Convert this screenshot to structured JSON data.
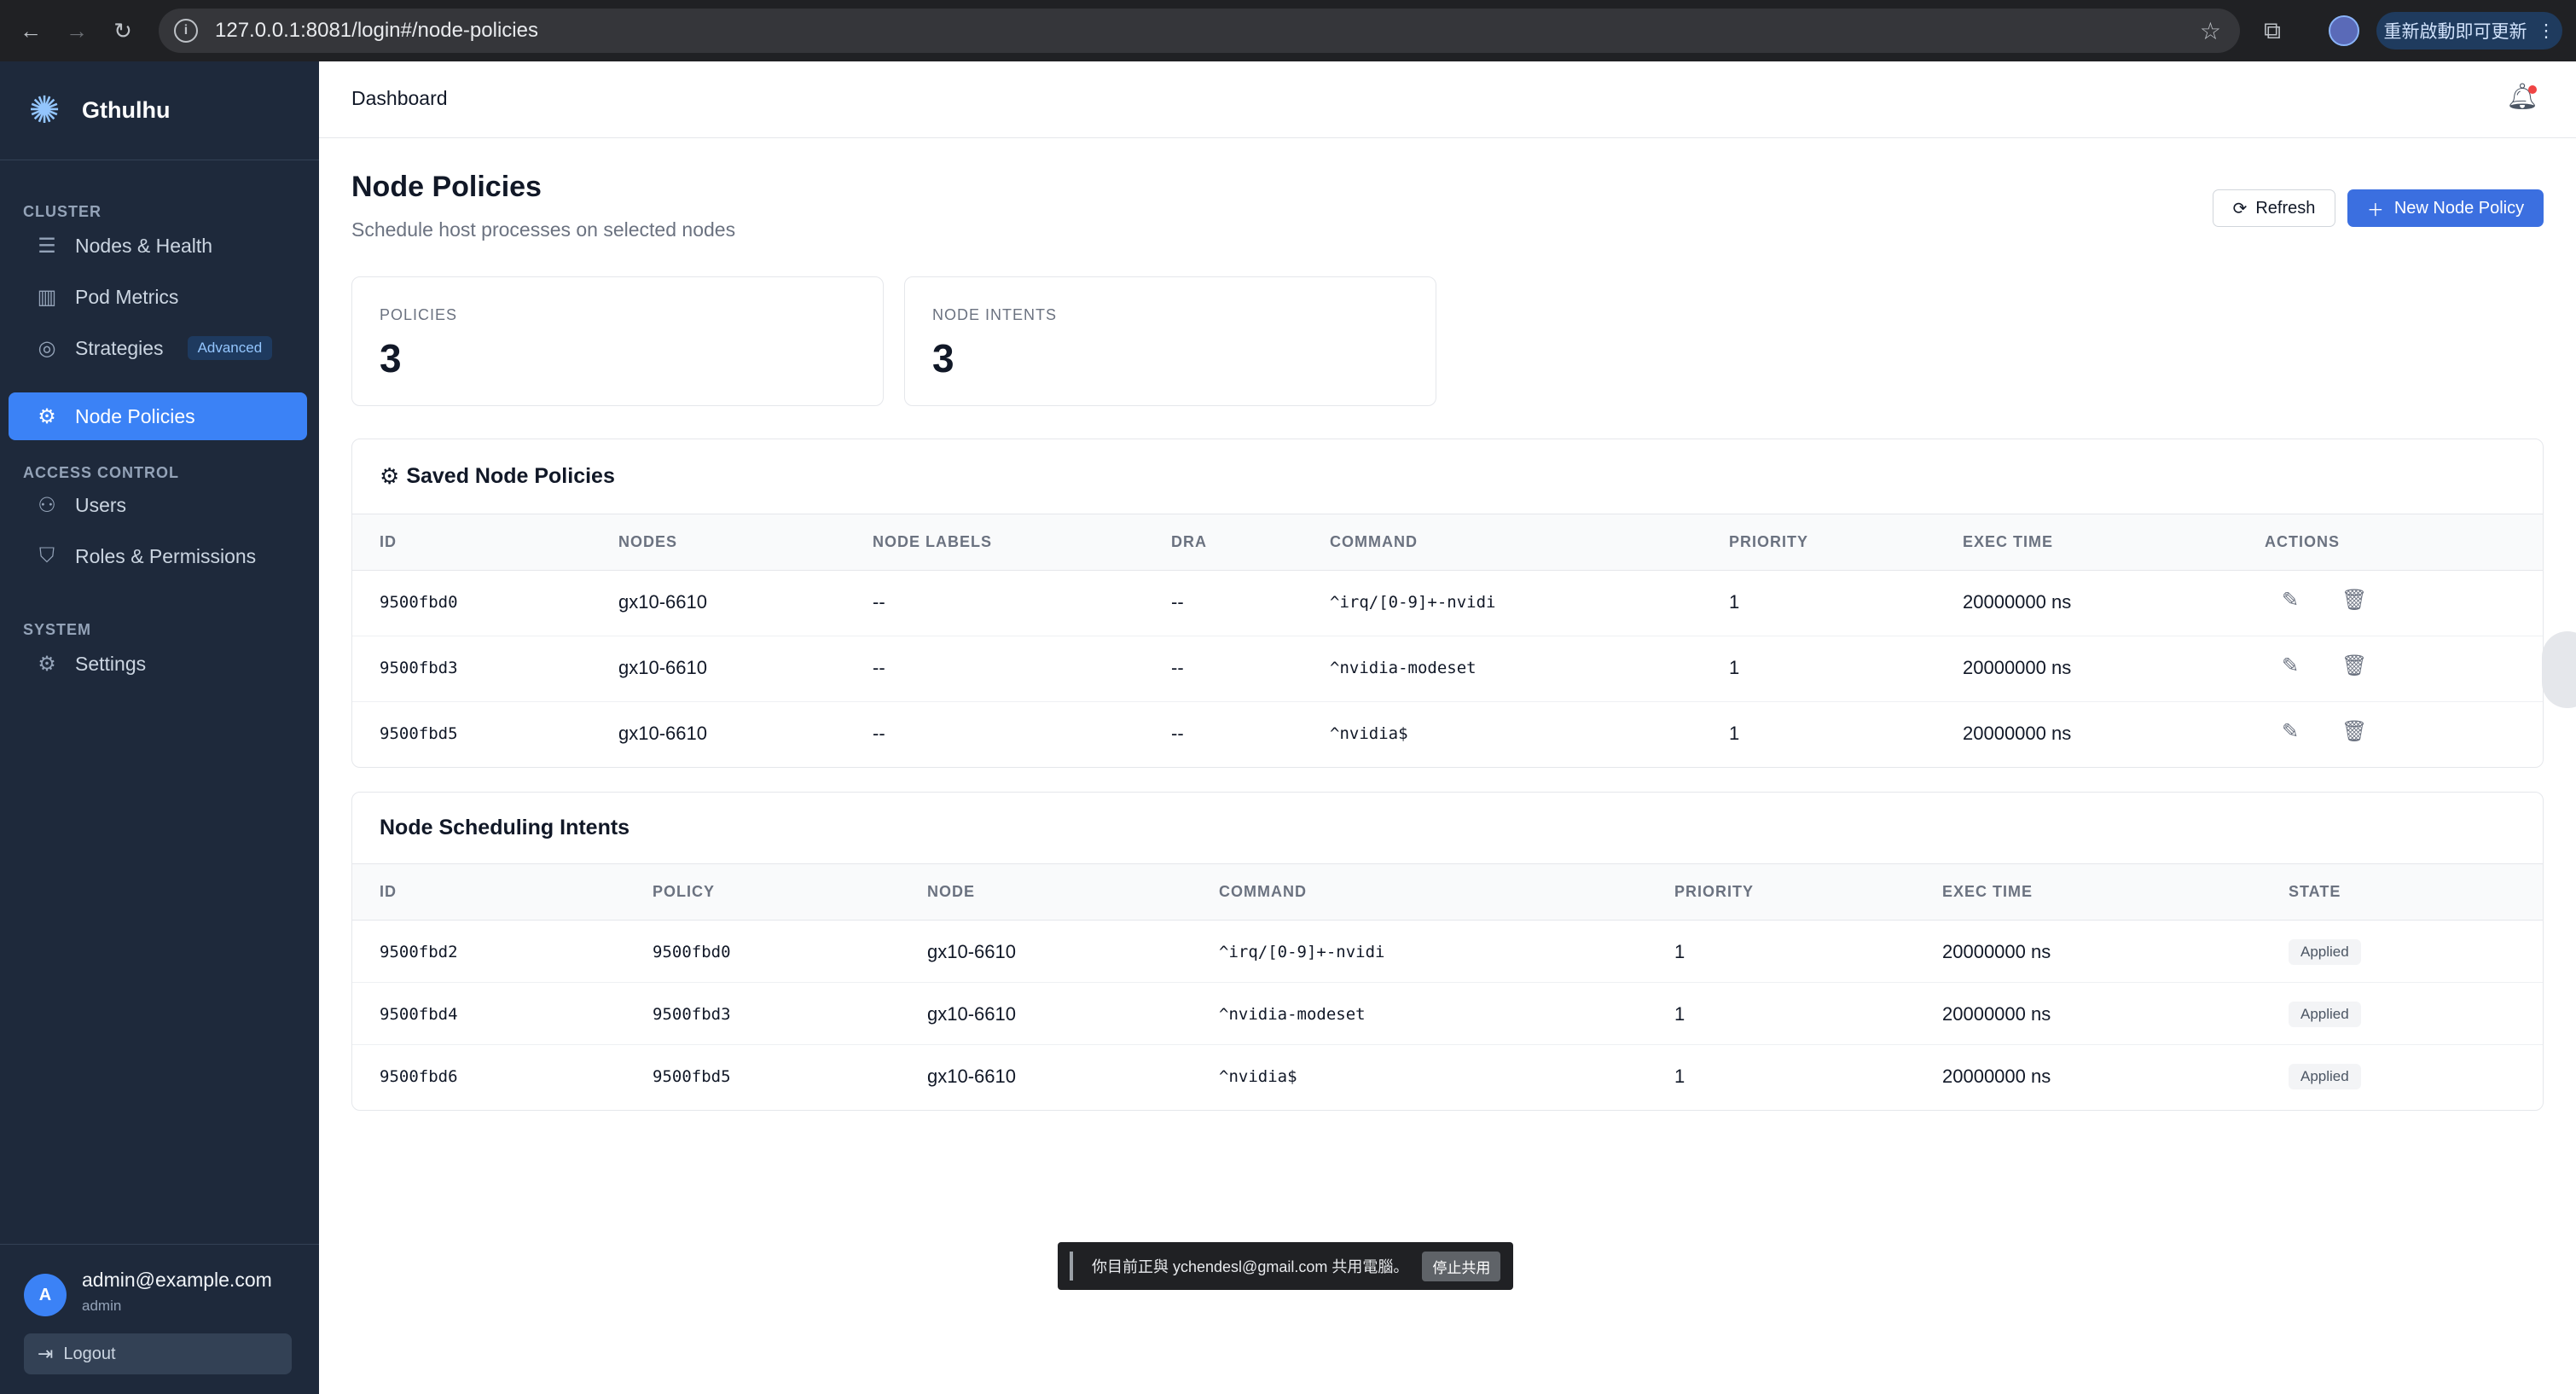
{
  "browser": {
    "url": "127.0.0.1:8081/login#/node-policies",
    "update_label": "重新啟動即可更新"
  },
  "sidebar": {
    "brand": "Gthulhu",
    "sections": {
      "cluster": "CLUSTER",
      "access": "ACCESS CONTROL",
      "system": "SYSTEM"
    },
    "items": [
      {
        "label": "Nodes & Health",
        "icon": "server-icon"
      },
      {
        "label": "Pod Metrics",
        "icon": "bar-chart-icon"
      },
      {
        "label": "Strategies",
        "icon": "target-icon",
        "badge": "Advanced"
      },
      {
        "label": "Node Policies",
        "icon": "cpu-icon",
        "active": true
      },
      {
        "label": "Users",
        "icon": "users-icon"
      },
      {
        "label": "Roles & Permissions",
        "icon": "shield-icon"
      },
      {
        "label": "Settings",
        "icon": "gear-icon"
      }
    ],
    "user": {
      "initial": "A",
      "email": "admin@example.com",
      "role": "admin",
      "logout": "Logout"
    }
  },
  "topbar": {
    "breadcrumb": "Dashboard"
  },
  "page": {
    "title": "Node Policies",
    "subtitle": "Schedule host processes on selected nodes",
    "refresh_label": "Refresh",
    "new_label": "New Node Policy"
  },
  "stats": [
    {
      "label": "POLICIES",
      "value": "3"
    },
    {
      "label": "NODE INTENTS",
      "value": "3"
    }
  ],
  "policies": {
    "title": "Saved Node Policies",
    "columns": [
      "ID",
      "NODES",
      "NODE LABELS",
      "DRA",
      "COMMAND",
      "PRIORITY",
      "EXEC TIME",
      "ACTIONS"
    ],
    "rows": [
      [
        "9500fbd0",
        "gx10-6610",
        "--",
        "--",
        "^irq/[0-9]+-nvidi",
        "1",
        "20000000 ns"
      ],
      [
        "9500fbd3",
        "gx10-6610",
        "--",
        "--",
        "^nvidia-modeset",
        "1",
        "20000000 ns"
      ],
      [
        "9500fbd5",
        "gx10-6610",
        "--",
        "--",
        "^nvidia$",
        "1",
        "20000000 ns"
      ]
    ]
  },
  "intents": {
    "title": "Node Scheduling Intents",
    "columns": [
      "ID",
      "POLICY",
      "NODE",
      "COMMAND",
      "PRIORITY",
      "EXEC TIME",
      "STATE"
    ],
    "rows": [
      [
        "9500fbd2",
        "9500fbd0",
        "gx10-6610",
        "^irq/[0-9]+-nvidi",
        "1",
        "20000000 ns",
        "Applied"
      ],
      [
        "9500fbd4",
        "9500fbd3",
        "gx10-6610",
        "^nvidia-modeset",
        "1",
        "20000000 ns",
        "Applied"
      ],
      [
        "9500fbd6",
        "9500fbd5",
        "gx10-6610",
        "^nvidia$",
        "1",
        "20000000 ns",
        "Applied"
      ]
    ]
  },
  "share_bar": {
    "text": "你目前正與 ychendesl@gmail.com 共用電腦。",
    "stop_label": "停止共用"
  },
  "colors": {
    "sidebar_bg": "#1e293b",
    "accent": "#3b82f6",
    "primary_button": "#3b6fe0"
  }
}
